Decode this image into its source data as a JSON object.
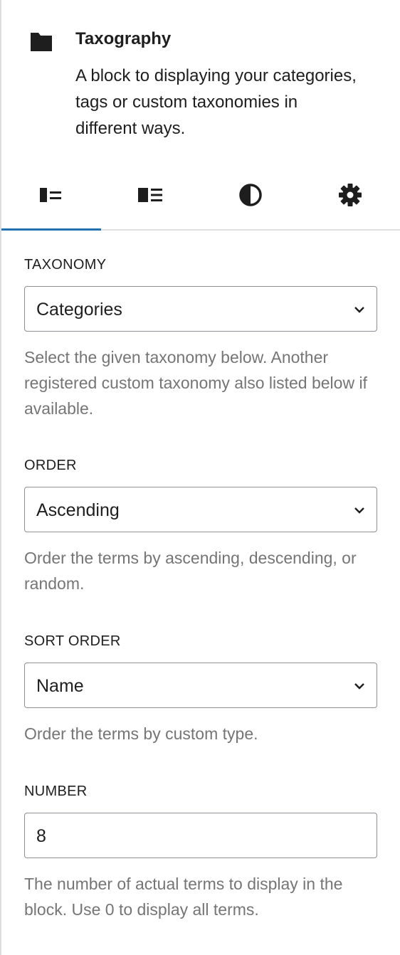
{
  "block": {
    "icon": "folder-icon",
    "title": "Taxography",
    "description": "A block to displaying your categories, tags or custom taxonomies in different ways."
  },
  "tabs": [
    {
      "icon": "layout-list-icon",
      "active": true
    },
    {
      "icon": "layout-list-alt-icon",
      "active": false
    },
    {
      "icon": "contrast-icon",
      "active": false
    },
    {
      "icon": "gear-icon",
      "active": false
    }
  ],
  "fields": {
    "taxonomy": {
      "label": "TAXONOMY",
      "value": "Categories",
      "help": "Select the given taxonomy below. Another registered custom taxonomy also listed below if available."
    },
    "order": {
      "label": "ORDER",
      "value": "Ascending",
      "help": "Order the terms by ascending, descending, or random."
    },
    "sort_order": {
      "label": "SORT ORDER",
      "value": "Name",
      "help": "Order the terms by custom type."
    },
    "number": {
      "label": "NUMBER",
      "value": "8",
      "help": "The number of actual terms to display in the block. Use 0 to display all terms."
    }
  },
  "colors": {
    "accent": "#2271b1",
    "text": "#1e1e1e",
    "help_text": "#757575",
    "border": "#8c8f94"
  }
}
